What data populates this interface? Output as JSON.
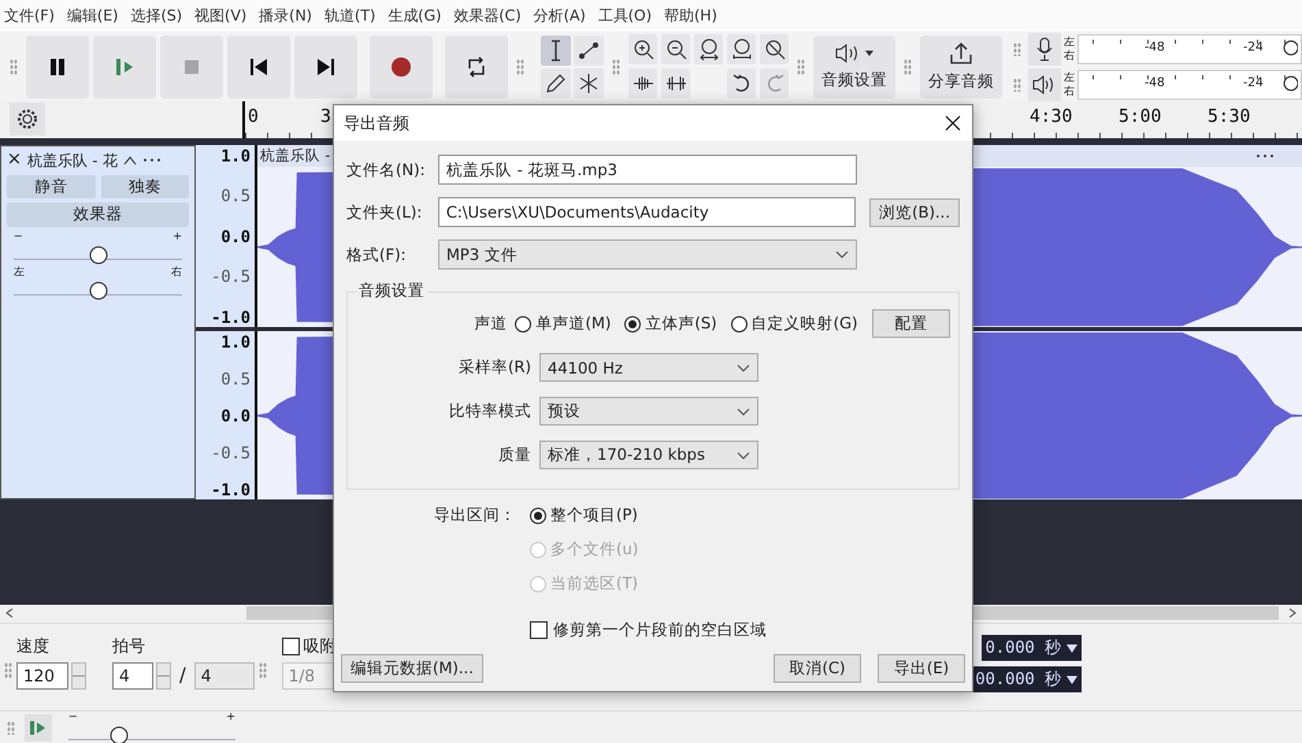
{
  "menu": [
    "文件(F)",
    "编辑(E)",
    "选择(S)",
    "视图(V)",
    "播录(N)",
    "轨道(T)",
    "生成(G)",
    "效果器(C)",
    "分析(A)",
    "工具(O)",
    "帮助(H)"
  ],
  "toolbar": {
    "audio_setup": "音频设置",
    "share": "分享音频"
  },
  "meters": [
    {
      "kind": "record",
      "left": "左",
      "right": "右",
      "ticks": [
        "-48",
        "-24"
      ]
    },
    {
      "kind": "playback",
      "left": "左",
      "right": "右",
      "ticks": [
        "-48",
        "-24"
      ]
    }
  ],
  "ruler": [
    "0",
    "3",
    "4:30",
    "5:00",
    "5:30"
  ],
  "track": {
    "close": "×",
    "name": "杭盖乐队 - 花",
    "mute": "静音",
    "solo": "独奏",
    "effects": "效果器",
    "gain": {
      "min": "−",
      "max": "+",
      "level": 0.5
    },
    "pan": {
      "min": "左",
      "max": "右",
      "level": 0.5
    },
    "clip_title": "杭盖乐队 -",
    "channels": [
      {
        "scale": [
          "1.0",
          "0.5",
          "0.0",
          "-0.5",
          "-1.0"
        ]
      },
      {
        "scale": [
          "1.0",
          "0.5",
          "0.0",
          "-0.5",
          "-1.0"
        ]
      }
    ]
  },
  "bottom": {
    "tempo_label": "速度",
    "tempo": "120",
    "meter_label": "拍号",
    "meter_num": "4",
    "slash": "/",
    "meter_den": "4",
    "snap": {
      "label": "吸附",
      "checked": false
    },
    "snap_value": "1/8",
    "time_top": "0.000 秒",
    "time_bottom": "00.000 秒",
    "speed": {
      "min": "−",
      "max": "+",
      "level": 0.3
    }
  },
  "dialog": {
    "title": "导出音频",
    "fields": [
      {
        "label": "文件名(N):",
        "value": "杭盖乐队 - 花斑马.mp3"
      },
      {
        "label": "文件夹(L):",
        "value": "C:\\Users\\XU\\Documents\\Audacity"
      }
    ],
    "browse": "浏览(B)...",
    "format": {
      "label": "格式(F):",
      "value": "MP3 文件"
    },
    "audio_group": "音频设置",
    "channels_label": "声道",
    "channel_options": [
      {
        "label": "单声道(M)",
        "selected": false
      },
      {
        "label": "立体声(S)",
        "selected": true
      },
      {
        "label": "自定义映射(G)",
        "selected": false
      }
    ],
    "configure": "配置",
    "selects": [
      {
        "label": "采样率(R)",
        "value": "44100 Hz"
      },
      {
        "label": "比特率模式",
        "value": "预设"
      },
      {
        "label": "质量",
        "value": "标准，170-210 kbps"
      }
    ],
    "range_label": "导出区间：",
    "ranges": [
      {
        "label": "整个项目(P)",
        "selected": true,
        "disabled": false
      },
      {
        "label": "多个文件(u)",
        "selected": false,
        "disabled": true
      },
      {
        "label": "当前选区(T)",
        "selected": false,
        "disabled": true
      }
    ],
    "trim": {
      "label": "修剪第一个片段前的空白区域",
      "checked": false
    },
    "metadata": "编辑元数据(M)...",
    "cancel": "取消(C)",
    "export": "导出(E)"
  }
}
